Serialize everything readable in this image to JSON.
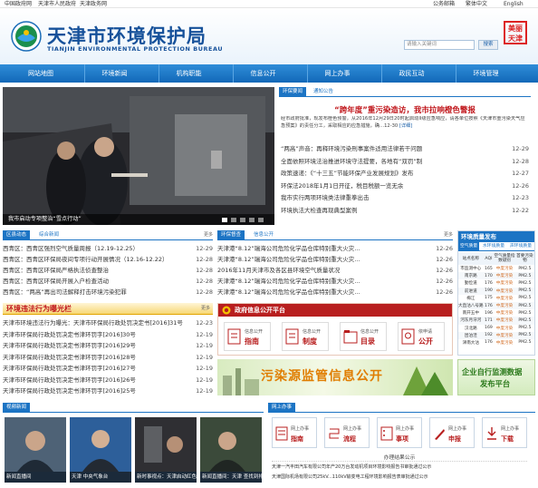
{
  "topbar": {
    "left": [
      "中国政府网",
      "天津市人民政府",
      "天津政务网"
    ],
    "right": [
      "公务邮箱",
      "繁体中文",
      "English"
    ]
  },
  "header": {
    "title_cn": "天津市环境保护局",
    "title_en": "TIANJIN ENVIRONMENTAL PROTECTION BUREAU",
    "search_placeholder": "请输入关键词",
    "search_button": "搜索",
    "seal_text": "美丽天津"
  },
  "nav": [
    "网站地图",
    "环境新闻",
    "机构职能",
    "信息公开",
    "网上办事",
    "政民互动",
    "环境管理"
  ],
  "slide": {
    "caption": "我市启动专项整治“雪点行动”",
    "dots": [
      "1",
      "2",
      "3",
      "4",
      "5"
    ]
  },
  "news": {
    "tabs": [
      "环保要闻",
      "通知公告"
    ],
    "headline": "“跨年度”重污染造访，我市拉响橙色警报",
    "summary": "经市政府批准，现发布橙色预警，从2016年12月29日20时起启动II级应急响应，请各单位按照《天津市重污染天气应急预案》的责任分工，采取相应的应急措施，确…12-30",
    "detail": "[详细]",
    "items": [
      {
        "t": "“两高”声音：再释环境污染刑事案件适用法律若干问题",
        "d": "12-29"
      },
      {
        "t": "全面依照环境法治推进环境守法提要，各地有“双罚”制",
        "d": "12-28"
      },
      {
        "t": "政策速递：《“十三五”节能环保产业发展规划》发布",
        "d": "12-27"
      },
      {
        "t": "环保法2018年1月1日开征，税目税额一览无余",
        "d": "12-26"
      },
      {
        "t": "我市实行两项环境类法律重拳出击",
        "d": "12-23"
      },
      {
        "t": "环境执法大检查再现典型案例",
        "d": "12-22"
      }
    ]
  },
  "dist": {
    "tabs": [
      "区县动态",
      "综合新闻"
    ],
    "more": "更多",
    "items": [
      {
        "t": "西青区：西青区强烈空气质量周报（12.19-12.25）",
        "d": "12-29"
      },
      {
        "t": "西青区：西青区环保局夜间专项行动开展情况（12.16-12.22）",
        "d": "12-28"
      },
      {
        "t": "西青区：西青区环保局严格执法侦查整治",
        "d": "12-28"
      },
      {
        "t": "西青区：西青区环保局开展入户检查活动",
        "d": "12-28"
      },
      {
        "t": "西青区：“两高”再出司法解释打击环境污染犯罪",
        "d": "12-28"
      }
    ]
  },
  "accident": {
    "tabs": [
      "环保督查",
      "信息公开"
    ],
    "more": "更多",
    "items": [
      {
        "t": "天津港“8.12”瑞海公司危险化学品仓库特别重大火灾…",
        "d": "12-26"
      },
      {
        "t": "天津港“8.12”瑞海公司危险化学品仓库特别重大火灾…",
        "d": "12-26"
      },
      {
        "t": "2016年11月天津市及各区县环境空气质量状况",
        "d": "12-26"
      },
      {
        "t": "天津港“8.12”瑞海公司危险化学品仓库特别重大火灾…",
        "d": "12-26"
      },
      {
        "t": "天津港“8.12”瑞海公司危险化学品仓库特别重大火灾…",
        "d": "12-26"
      }
    ]
  },
  "violations": {
    "title": "环境违法行为曝光栏",
    "more": "更多",
    "items": [
      {
        "t": "天津市环境违法行为曝光：天津市环保局行政处罚决定书[2016]31号",
        "d": "12-23"
      },
      {
        "t": "天津市环保局行政处罚决定书津环罚字[2016]30号",
        "d": "12-19"
      },
      {
        "t": "天津市环保局行政处罚决定书津环罚字[2016]29号",
        "d": "12-19"
      },
      {
        "t": "天津市环保局行政处罚决定书津环罚字[2016]28号",
        "d": "12-19"
      },
      {
        "t": "天津市环保局行政处罚决定书津环罚字[2016]27号",
        "d": "12-19"
      },
      {
        "t": "天津市环保局行政处罚决定书津环罚字[2016]26号",
        "d": "12-19"
      },
      {
        "t": "天津市环保局行政处罚决定书津环罚字[2016]25号",
        "d": "12-19"
      },
      {
        "t": "天津市环保局行政处罚决定书津环罚字[2016]24号",
        "d": "12-19"
      }
    ]
  },
  "info_platform": {
    "title": "政府信息公开平台",
    "buttons": [
      {
        "top": "信息公开",
        "bottom": "指南"
      },
      {
        "top": "信息公开",
        "bottom": "制度"
      },
      {
        "top": "信息公开",
        "bottom": "目录"
      },
      {
        "top": "依申请",
        "bottom": "公开"
      }
    ]
  },
  "pollution_banner": "污染源监管信息公开",
  "aq": {
    "title": "环境质量发布",
    "tabs": [
      "空气质量",
      "水环境质量",
      "声环境质量"
    ],
    "headers": [
      "站点名称",
      "AQI",
      "空气质量指数级别",
      "首要污染物"
    ],
    "rows": [
      [
        "市监测中心",
        "165",
        "中度污染",
        "PM2.5"
      ],
      [
        "南京路",
        "170",
        "中度污染",
        "PM2.5"
      ],
      [
        "勤俭道",
        "176",
        "中度污染",
        "PM2.5"
      ],
      [
        "前进道",
        "190",
        "中度污染",
        "PM2.5"
      ],
      [
        "梅江",
        "175",
        "中度污染",
        "PM2.5"
      ],
      [
        "大直沽八号路",
        "176",
        "中度污染",
        "PM2.5"
      ],
      [
        "南开五中",
        "196",
        "中度污染",
        "PM2.5"
      ],
      [
        "河东月牙河",
        "171",
        "中度污染",
        "PM2.5"
      ],
      [
        "汉北路",
        "169",
        "中度污染",
        "PM2.5"
      ],
      [
        "团泊洼",
        "192",
        "中度污染",
        "PM2.5"
      ],
      [
        "津南大沽",
        "176",
        "中度污染",
        "PM2.5"
      ]
    ]
  },
  "enterprise": {
    "line1": "企业自行监测数据",
    "line2": "发布平台"
  },
  "video": {
    "tab": "视频新闻",
    "captions": [
      "新闻直播间",
      "天津 中央气象台",
      "新时事视点：天津启动红色预警处置",
      "新闻直播间：天津 查找到排污原因"
    ]
  },
  "office": {
    "tab": "网上办事",
    "buttons": [
      {
        "top": "网上办事",
        "bottom": "指南"
      },
      {
        "top": "网上办事",
        "bottom": "流程"
      },
      {
        "top": "网上办事",
        "bottom": "事项"
      },
      {
        "top": "网上办事",
        "bottom": "申报"
      },
      {
        "top": "网上办事",
        "bottom": "下载"
      }
    ],
    "notice_title": "办理结果公示",
    "notices": [
      "天津一汽丰田汽车有限公司年产20万台发动机项目环境影响报告书审批通过公示",
      "天津国际机场有限公司25kV...110kV输变电工程环境影响报告表审批通过公示"
    ]
  }
}
